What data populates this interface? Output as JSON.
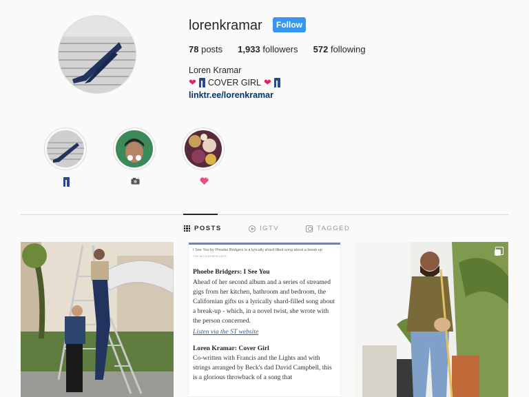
{
  "profile": {
    "username": "lorenkramar",
    "follow_label": "Follow",
    "stats": {
      "posts_count": "78",
      "posts_label": "posts",
      "followers_count": "1,933",
      "followers_label": "followers",
      "following_count": "572",
      "following_label": "following"
    },
    "full_name": "Loren Kramar",
    "bio_text": "COVER GIRL",
    "bio_emojis": [
      "red-heart",
      "jeans",
      "red-heart",
      "jeans"
    ],
    "link": "linktr.ee/lorenkramar"
  },
  "highlights": [
    {
      "label_icon": "jeans-icon"
    },
    {
      "label_icon": "camera-flash-icon"
    },
    {
      "label_icon": "sparkling-heart-icon"
    }
  ],
  "tabs": [
    {
      "label": "POSTS",
      "icon": "grid-icon",
      "active": true
    },
    {
      "label": "IGTV",
      "icon": "igtv-icon",
      "active": false
    },
    {
      "label": "TAGGED",
      "icon": "tagged-icon",
      "active": false
    }
  ],
  "posts": {
    "article": {
      "caption": "I See You by Phoebe Bridgers is a lyrically shard-filled song about a break-up",
      "credit": "TIM MOSSENFELDER",
      "section1_title": "Phoebe Bridgers: I See You",
      "section1_body": "Ahead of her second album and a series of streamed gigs from her kitchen, bathroom and bedroom, the Californian gifts us a lyrically shard-filled song about a break-up - which, in a novel twist, she wrote with the person concerned.",
      "section1_link": "Listen via the ST website",
      "section2_title": "Loren Kramar: Cover Girl",
      "section2_body": "Co-written with Francis and the Lights and with strings arranged by Beck's dad David Campbell, this is a glorious throwback of a song that"
    }
  },
  "colors": {
    "follow_button": "#3897f0",
    "link": "#003569",
    "text": "#262626",
    "muted": "#999999",
    "background": "#fafafa"
  }
}
